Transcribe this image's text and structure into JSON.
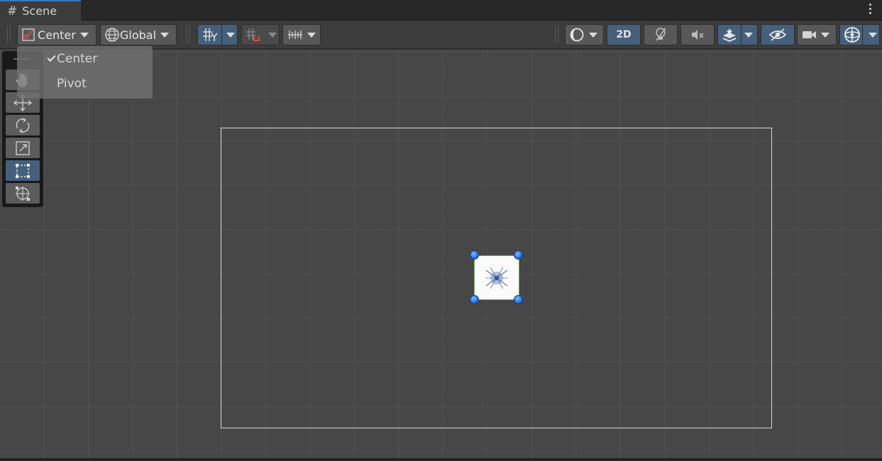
{
  "tab": {
    "title": "Scene",
    "icon": "hash-grid-icon"
  },
  "toolbar": {
    "pivot_mode_label": "Center",
    "pivot_rotation_label": "Global",
    "mode_2d_label": "2D"
  },
  "pivot_menu": {
    "items": [
      {
        "label": "Center",
        "checked": true
      },
      {
        "label": "Pivot",
        "checked": false
      }
    ]
  },
  "tools": [
    {
      "name": "view-tool",
      "icon": "hand-icon"
    },
    {
      "name": "move-tool",
      "icon": "move-arrows-icon"
    },
    {
      "name": "rotate-tool",
      "icon": "rotate-icon"
    },
    {
      "name": "scale-tool",
      "icon": "scale-icon"
    },
    {
      "name": "rect-tool",
      "icon": "rect-transform-icon",
      "selected": true
    },
    {
      "name": "transform-tool",
      "icon": "transform-icon"
    }
  ],
  "colors": {
    "accent": "#46607c",
    "handle": "#1c63d6",
    "scene_bg": "#474747"
  }
}
